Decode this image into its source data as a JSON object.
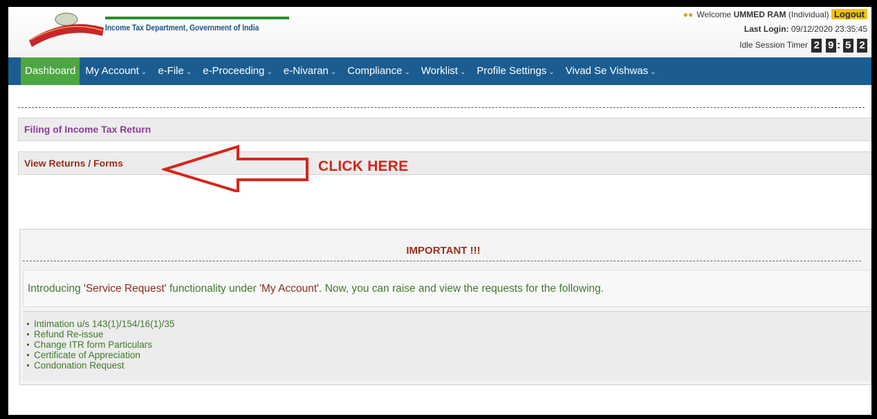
{
  "header": {
    "department": "Income Tax Department, Government of India",
    "welcome_prefix": "Welcome",
    "user_name": "UMMED RAM",
    "user_type": "(Individual)",
    "logout": "Logout",
    "last_login_label": "Last Login:",
    "last_login_value": "09/12/2020 23:35:45",
    "idle_label": "Idle Session Timer",
    "timer_digits": [
      "2",
      "9",
      "5",
      "2"
    ]
  },
  "nav": {
    "items": [
      {
        "label": "Dashboard",
        "caret": ""
      },
      {
        "label": "My Account",
        "caret": "⌄"
      },
      {
        "label": "e-File",
        "caret": "⌄"
      },
      {
        "label": "e-Proceeding",
        "caret": "⌄"
      },
      {
        "label": "e-Nivaran",
        "caret": "⌄"
      },
      {
        "label": "Compliance",
        "caret": "⌄"
      },
      {
        "label": "Worklist",
        "caret": "⌄"
      },
      {
        "label": "Profile Settings",
        "caret": "⌄"
      },
      {
        "label": "Vivad Se Vishwas",
        "caret": "⌄"
      }
    ]
  },
  "content": {
    "filing_title": "Filing of Income Tax Return",
    "view_returns": "View Returns / Forms",
    "click_here": "CLICK HERE",
    "important_title": "IMPORTANT !!!",
    "intro_part1": "Introducing ",
    "intro_quote1": "'Service Request'",
    "intro_part2": " functionality under ",
    "intro_quote2": "'My Account'",
    "intro_part3": ". Now, you can raise and view the requests for the following.",
    "requests": [
      "Intimation u/s 143(1)/154/16(1)/35",
      "Refund Re-issue",
      "Change ITR form Particulars",
      "Certificate of Appreciation",
      "Condonation Request"
    ]
  },
  "colors": {
    "nav_bg": "#1b5d91",
    "active_tab": "#4ea642",
    "arrow": "#d9241b",
    "logout_bg": "#f5c200"
  }
}
